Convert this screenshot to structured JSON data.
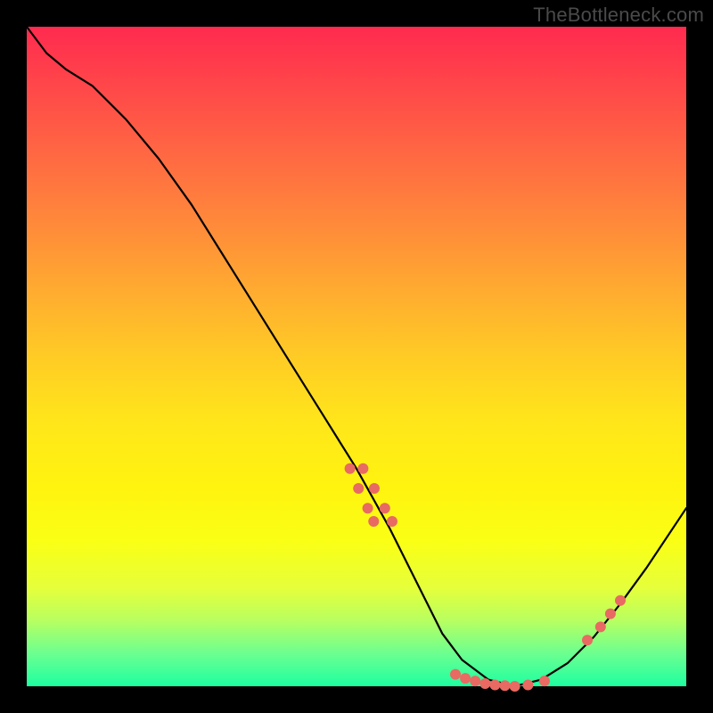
{
  "watermark": {
    "text": "TheBottleneck.com"
  },
  "colors": {
    "background": "#000000",
    "gradient_top": "#ff2a4f",
    "gradient_bottom": "#1effa0",
    "curve_stroke": "#000000",
    "dot_fill": "#e86a62",
    "watermark_text": "#4a4a4a"
  },
  "chart_data": {
    "type": "line",
    "title": "",
    "xlabel": "",
    "ylabel": "",
    "xlim": [
      0,
      100
    ],
    "ylim": [
      0,
      100
    ],
    "grid": false,
    "legend": false,
    "x": [
      0,
      3,
      6,
      10,
      15,
      20,
      25,
      30,
      35,
      40,
      45,
      50,
      55,
      60,
      63,
      66,
      70,
      74,
      78,
      82,
      86,
      90,
      94,
      100
    ],
    "values": [
      100,
      96,
      93.5,
      91,
      86,
      80,
      73,
      65,
      57,
      49,
      41,
      33,
      24,
      14,
      8,
      4,
      1,
      0,
      1,
      3.5,
      7.5,
      12.5,
      18,
      27
    ],
    "annotations": [
      {
        "type": "scatter-dot-offset",
        "x_offset": -1,
        "x": 50,
        "y": 33
      },
      {
        "type": "scatter-dot-offset",
        "x_offset": 1,
        "x": 50,
        "y": 33
      },
      {
        "type": "scatter-dot-offset",
        "x_offset": -1.2,
        "x": 51.5,
        "y": 30
      },
      {
        "type": "scatter-dot-offset",
        "x_offset": 1.2,
        "x": 51.5,
        "y": 30
      },
      {
        "type": "scatter-dot-offset",
        "x_offset": -1.3,
        "x": 53,
        "y": 27
      },
      {
        "type": "scatter-dot-offset",
        "x_offset": 1.3,
        "x": 53,
        "y": 27
      },
      {
        "type": "scatter-dot-offset",
        "x_offset": -1.4,
        "x": 54,
        "y": 25
      },
      {
        "type": "scatter-dot-offset",
        "x_offset": 1.4,
        "x": 54,
        "y": 25
      },
      {
        "type": "scatter-dot",
        "x": 65,
        "y": 1.8
      },
      {
        "type": "scatter-dot",
        "x": 66.5,
        "y": 1.2
      },
      {
        "type": "scatter-dot",
        "x": 68,
        "y": 0.8
      },
      {
        "type": "scatter-dot",
        "x": 69.5,
        "y": 0.4
      },
      {
        "type": "scatter-dot",
        "x": 71,
        "y": 0.2
      },
      {
        "type": "scatter-dot",
        "x": 72.5,
        "y": 0.1
      },
      {
        "type": "scatter-dot",
        "x": 74,
        "y": 0
      },
      {
        "type": "scatter-dot",
        "x": 76,
        "y": 0.2
      },
      {
        "type": "scatter-dot",
        "x": 78.5,
        "y": 0.8
      },
      {
        "type": "scatter-dot",
        "x": 85,
        "y": 7
      },
      {
        "type": "scatter-dot",
        "x": 87,
        "y": 9
      },
      {
        "type": "scatter-dot",
        "x": 88.5,
        "y": 11
      },
      {
        "type": "scatter-dot",
        "x": 90,
        "y": 13
      }
    ]
  }
}
